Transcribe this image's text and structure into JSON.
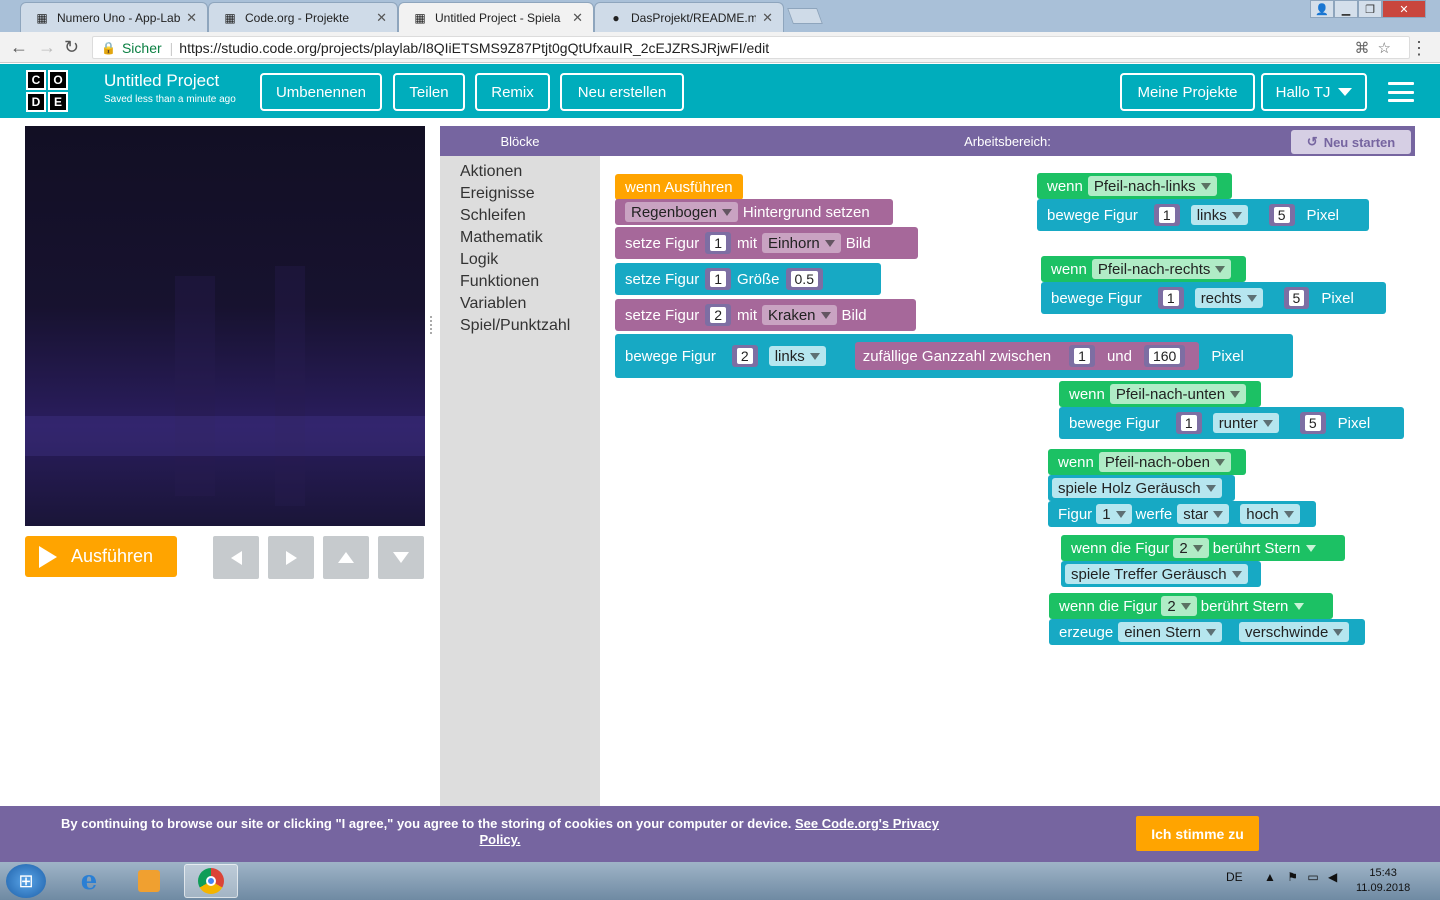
{
  "browser": {
    "tabs": [
      {
        "title": "Numero Uno - App-Labo",
        "icon": "codeorg-favicon"
      },
      {
        "title": "Code.org - Projekte",
        "icon": "codeorg-favicon"
      },
      {
        "title": "Untitled Project - Spiela",
        "icon": "codeorg-favicon"
      },
      {
        "title": "DasProjekt/README.md",
        "icon": "github-favicon"
      }
    ],
    "secure_label": "Sicher",
    "url": "https://studio.code.org/projects/playlab/I8QIiETSMS9Z87Ptjt0gQtUfxauIR_2cEJZRSJRjwFI/edit"
  },
  "header": {
    "logo_letters": [
      "C",
      "O",
      "D",
      "E"
    ],
    "project_title": "Untitled Project",
    "project_subtitle": "Saved less than a minute ago",
    "rename": "Umbenennen",
    "share": "Teilen",
    "remix": "Remix",
    "new": "Neu erstellen",
    "my_projects": "Meine Projekte",
    "user": "Hallo TJ"
  },
  "stage": {
    "run": "Ausführen"
  },
  "toolbox": {
    "title": "Blöcke",
    "categories": [
      "Aktionen",
      "Ereignisse",
      "Schleifen",
      "Mathematik",
      "Logik",
      "Funktionen",
      "Variablen",
      "Spiel/Punktzahl"
    ]
  },
  "workspace": {
    "title": "Arbeitsbereich:",
    "restart": "Neu starten"
  },
  "blocks": {
    "when_run": "wenn Ausführen",
    "bg_dd": "Regenbogen",
    "bg_label": "Hintergrund setzen",
    "set_figure": "setze Figur",
    "with": "mit",
    "image": "Bild",
    "unicorn": "Einhorn",
    "kraken": "Kraken",
    "size": "Größe",
    "size_val": "0.5",
    "one": "1",
    "two": "2",
    "five": "5",
    "move": "bewege Figur",
    "left": "links",
    "right": "rechts",
    "down": "runter",
    "up_dir": "hoch",
    "random": "zufällige Ganzzahl zwischen",
    "and": "und",
    "max": "160",
    "pixel": "Pixel",
    "when": "wenn",
    "arrow_left": "Pfeil-nach-links",
    "arrow_right": "Pfeil-nach-rechts",
    "arrow_down": "Pfeil-nach-unten",
    "arrow_up": "Pfeil-nach-oben",
    "play_wood": "spiele Holz Geräusch",
    "figure": "Figur",
    "throw": "werfe",
    "star": "star",
    "when_figure": "wenn die Figur",
    "touches_star": "berührt Stern",
    "play_hit": "spiele Treffer Geräusch",
    "create": "erzeuge",
    "a_star": "einen Stern",
    "vanish": "verschwinde"
  },
  "cookie": {
    "text": "By continuing to browse our site or clicking \"I agree,\" you agree to the storing of cookies on your computer or device.",
    "link": "See Code.org's Privacy Policy.",
    "agree": "Ich stimme zu"
  },
  "taskbar": {
    "lang": "DE",
    "time": "15:43",
    "date": "11.09.2018"
  },
  "colors": {
    "codeorg_teal": "#00adbc",
    "header_purple": "#7665a0",
    "run_orange": "#ffa400",
    "event_green": "#1cc164",
    "action_teal": "#17a9c4",
    "sprite_purple": "#a6689a"
  }
}
